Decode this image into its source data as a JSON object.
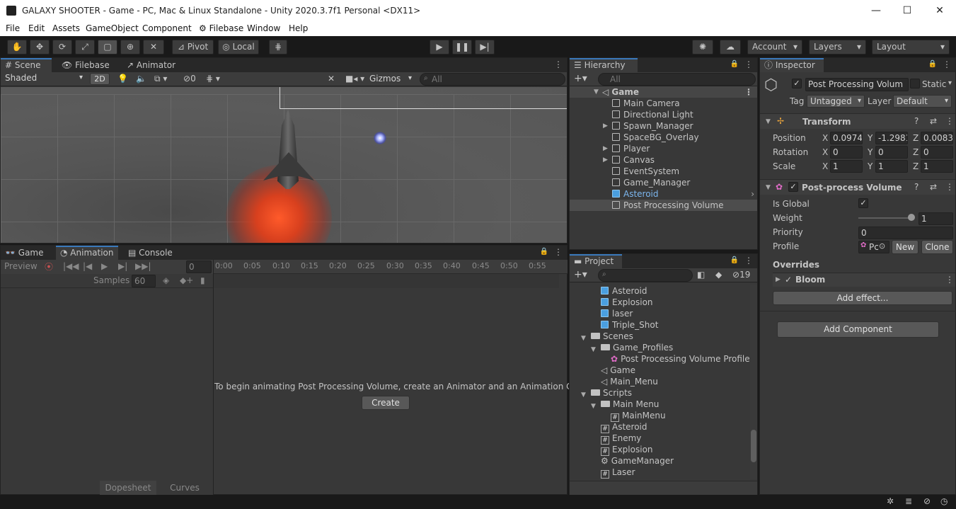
{
  "window": {
    "title": "GALAXY SHOOTER - Game - PC, Mac & Linux Standalone - Unity 2020.3.7f1 Personal <DX11>"
  },
  "menu": [
    "File",
    "Edit",
    "Assets",
    "GameObject",
    "Component",
    "Filebase",
    "Window",
    "Help"
  ],
  "toolbar": {
    "pivot": "Pivot",
    "local": "Local",
    "account": "Account",
    "layers": "Layers",
    "layout": "Layout"
  },
  "scene": {
    "tabs": [
      "Scene",
      "Filebase",
      "Animator"
    ],
    "shading": "Shaded",
    "mode2d": "2D",
    "hidden_count": "0",
    "gizmos": "Gizmos",
    "search_placeholder": "All"
  },
  "hierarchy": {
    "tab": "Hierarchy",
    "search_placeholder": "All",
    "scene": "Game",
    "items": [
      "Main Camera",
      "Directional Light",
      "Spawn_Manager",
      "SpaceBG_Overlay",
      "Player",
      "Canvas",
      "EventSystem",
      "Game_Manager",
      "Asteroid",
      "Post Processing Volume"
    ]
  },
  "inspector": {
    "tab": "Inspector",
    "object_name": "Post Processing Volum",
    "static_label": "Static",
    "tag_label": "Tag",
    "tag_value": "Untagged",
    "layer_label": "Layer",
    "layer_value": "Default",
    "transform": {
      "title": "Transform",
      "position": {
        "label": "Position",
        "x": "0.0974",
        "y": "-1.2981",
        "z": "0.0083"
      },
      "rotation": {
        "label": "Rotation",
        "x": "0",
        "y": "0",
        "z": "0"
      },
      "scale": {
        "label": "Scale",
        "x": "1",
        "y": "1",
        "z": "1"
      }
    },
    "ppv": {
      "title": "Post-process Volume",
      "is_global": "Is Global",
      "weight": "Weight",
      "weight_value": "1",
      "weight_fraction": 1,
      "priority": "Priority",
      "priority_value": "0",
      "profile": "Profile",
      "profile_value": "Pc",
      "new": "New",
      "clone": "Clone",
      "overrides": "Overrides",
      "bloom": "Bloom",
      "add_effect": "Add effect..."
    },
    "add_component": "Add Component"
  },
  "bottom": {
    "tabs": [
      "Game",
      "Animation",
      "Console"
    ],
    "preview": "Preview",
    "frame": "0",
    "samples_label": "Samples",
    "samples_value": "60",
    "ticks": [
      "0:00",
      "0:05",
      "0:10",
      "0:15",
      "0:20",
      "0:25",
      "0:30",
      "0:35",
      "0:40",
      "0:45",
      "0:50",
      "0:55"
    ],
    "message": "To begin animating Post Processing Volume, create an Animator and an Animation Clip.",
    "create": "Create",
    "dopesheet": "Dopesheet",
    "curves": "Curves"
  },
  "project": {
    "tab": "Project",
    "hidden_count": "19",
    "items": [
      {
        "name": "Asteroid",
        "type": "prefab",
        "indent": 2
      },
      {
        "name": "Explosion",
        "type": "prefab",
        "indent": 2
      },
      {
        "name": "laser",
        "type": "prefab",
        "indent": 2
      },
      {
        "name": "Triple_Shot",
        "type": "prefab",
        "indent": 2
      },
      {
        "name": "Scenes",
        "type": "folder",
        "indent": 1
      },
      {
        "name": "Game_Profiles",
        "type": "folder",
        "indent": 2
      },
      {
        "name": "Post Processing Volume Profile",
        "type": "profile",
        "indent": 3
      },
      {
        "name": "Game",
        "type": "scene",
        "indent": 2
      },
      {
        "name": "Main_Menu",
        "type": "scene",
        "indent": 2
      },
      {
        "name": "Scripts",
        "type": "folder",
        "indent": 1
      },
      {
        "name": "Main Menu",
        "type": "folder",
        "indent": 2
      },
      {
        "name": "MainMenu",
        "type": "script",
        "indent": 3
      },
      {
        "name": "Asteroid",
        "type": "script",
        "indent": 2
      },
      {
        "name": "Enemy",
        "type": "script",
        "indent": 2
      },
      {
        "name": "Explosion",
        "type": "script",
        "indent": 2
      },
      {
        "name": "GameManager",
        "type": "gear",
        "indent": 2
      },
      {
        "name": "Laser",
        "type": "script",
        "indent": 2
      }
    ]
  }
}
